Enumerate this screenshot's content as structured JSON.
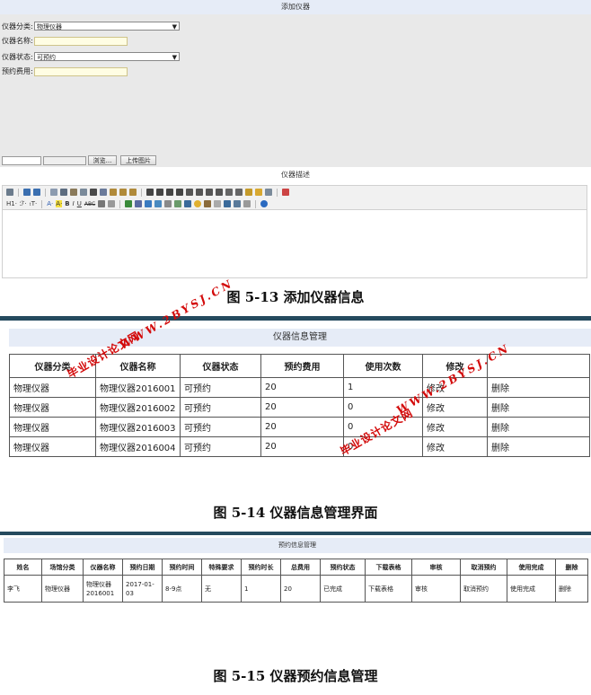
{
  "figure_13": {
    "title": "添加仪器",
    "fields": [
      {
        "label": "仪器分类:",
        "type": "select",
        "value": "物理仪器"
      },
      {
        "label": "仪器名称:",
        "type": "input",
        "value": ""
      },
      {
        "label": "仪器状态:",
        "type": "select",
        "value": "可预约"
      },
      {
        "label": "预约费用:",
        "type": "input",
        "value": ""
      }
    ],
    "browse_label": "浏览...",
    "upload_label": "上传图片",
    "description_label": "仪器描述",
    "toolbar_labels": {
      "heading": "H1·",
      "font": "ℱ·",
      "size": "ₜT·",
      "fontcolor": "A·",
      "bgcolor": "A·",
      "bold": "B",
      "italic": "I",
      "underline": "U",
      "strike": "ABC"
    },
    "caption": "图 5-13 添加仪器信息"
  },
  "figure_14": {
    "title": "仪器信息管理",
    "columns": [
      "仪器分类",
      "仪器名称",
      "仪器状态",
      "预约费用",
      "使用次数",
      "修改",
      ""
    ],
    "rows": [
      [
        "物理仪器",
        "物理仪器2016001",
        "可预约",
        "20",
        "1",
        "修改",
        "删除"
      ],
      [
        "物理仪器",
        "物理仪器2016002",
        "可预约",
        "20",
        "0",
        "修改",
        "删除"
      ],
      [
        "物理仪器",
        "物理仪器2016003",
        "可预约",
        "20",
        "0",
        "修改",
        "删除"
      ],
      [
        "物理仪器",
        "物理仪器2016004",
        "可预约",
        "20",
        "0",
        "修改",
        "删除"
      ]
    ],
    "caption": "图 5-14 仪器信息管理界面"
  },
  "figure_15": {
    "title": "预约信息管理",
    "columns": [
      "姓名",
      "场馆分类",
      "仪器名称",
      "预约日期",
      "预约时间",
      "特殊要求",
      "预约时长",
      "总费用",
      "预约状态",
      "下载表格",
      "审核",
      "取消预约",
      "使用完成",
      "删除"
    ],
    "rows": [
      [
        "李飞",
        "物理仪器",
        "物理仪器2016001",
        "2017-01-03",
        "8-9点",
        "无",
        "1",
        "20",
        "已完成",
        "下载表格",
        "审核",
        "取消预约",
        "使用完成",
        "删除"
      ]
    ],
    "caption": "图 5-15 仪器预约信息管理"
  },
  "watermark": {
    "url": "WWW.2BYSJ.CN",
    "text": "毕业设计论文网"
  },
  "colors": {
    "header_bg": "#e6ecf7",
    "form_bg": "#e9e9e9",
    "topbar": "#254a5e",
    "watermark": "#d30b0b"
  }
}
